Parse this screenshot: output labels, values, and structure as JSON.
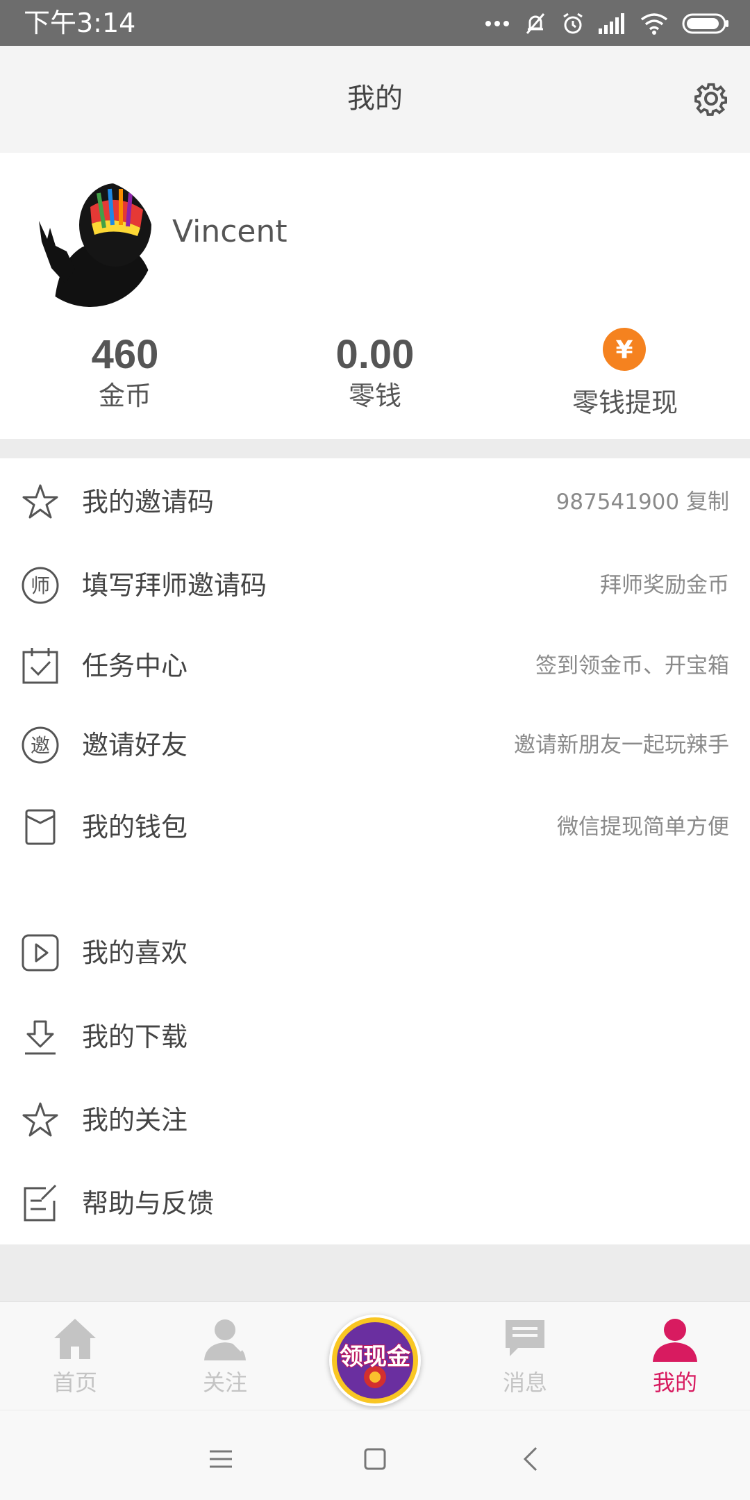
{
  "status_bar": {
    "time": "下午3:14",
    "icons": [
      "more-dots-icon",
      "mute-bell-icon",
      "alarm-icon",
      "signal-icon",
      "wifi-icon",
      "battery-icon"
    ]
  },
  "header": {
    "title": "我的",
    "settings_icon": "gear-icon"
  },
  "profile": {
    "username": "Vincent",
    "stats": [
      {
        "value": "460",
        "label": "金币"
      },
      {
        "value": "0.00",
        "label": "零钱"
      }
    ],
    "withdraw": {
      "icon_glyph": "¥",
      "label": "零钱提现",
      "icon_color": "#f5821f"
    }
  },
  "menu_primary": [
    {
      "icon": "star-icon",
      "label": "我的邀请码",
      "hint": "987541900 复制"
    },
    {
      "icon": "master-icon",
      "icon_glyph": "师",
      "label": "填写拜师邀请码",
      "hint": "拜师奖励金币"
    },
    {
      "icon": "calendar-check-icon",
      "label": "任务中心",
      "hint": "签到领金币、开宝箱"
    },
    {
      "icon": "invite-icon",
      "icon_glyph": "邀",
      "label": "邀请好友",
      "hint": "邀请新朋友一起玩辣手"
    },
    {
      "icon": "wallet-icon",
      "label": "我的钱包",
      "hint": "微信提现简单方便"
    }
  ],
  "menu_secondary": [
    {
      "icon": "play-icon",
      "label": "我的喜欢"
    },
    {
      "icon": "download-icon",
      "label": "我的下载"
    },
    {
      "icon": "star-icon",
      "label": "我的关注"
    },
    {
      "icon": "edit-icon",
      "label": "帮助与反馈"
    }
  ],
  "tabbar": {
    "tabs": [
      {
        "icon": "home-icon",
        "label": "首页",
        "active": false
      },
      {
        "icon": "follow-icon",
        "label": "关注",
        "active": false
      },
      {
        "icon": "message-icon",
        "label": "消息",
        "active": false
      },
      {
        "icon": "profile-icon",
        "label": "我的",
        "active": true
      }
    ],
    "center_button": {
      "text": "领现金",
      "icon": "cash-reward-icon"
    },
    "active_color": "#d81b60",
    "inactive_color": "#c4c4c4"
  },
  "system_nav": [
    "menu-icon",
    "home-square-icon",
    "back-chevron-icon"
  ]
}
